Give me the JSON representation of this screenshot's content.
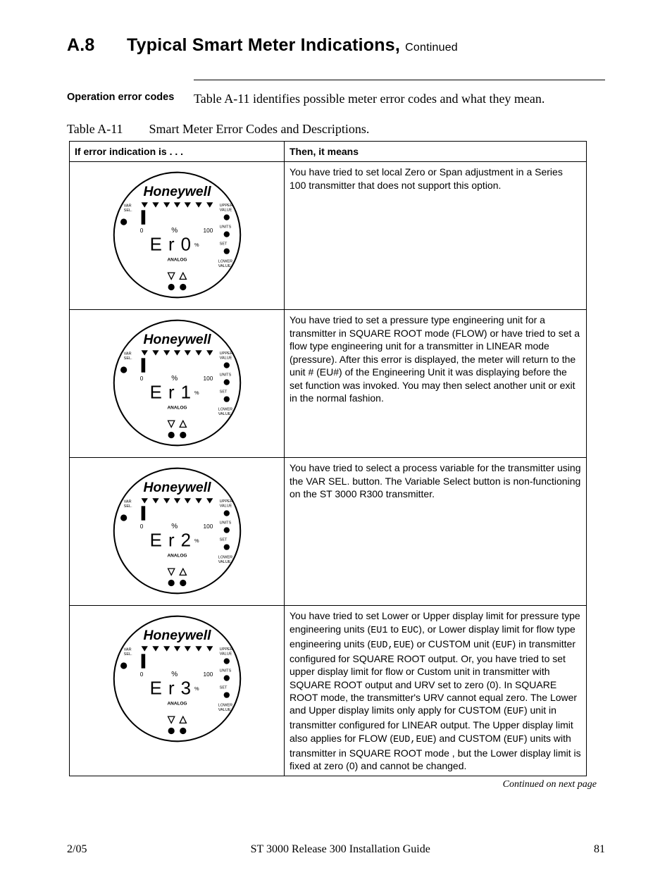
{
  "heading": {
    "number": "A.8",
    "title": "Typical Smart Meter Indications,",
    "cont": "Continued"
  },
  "intro": {
    "label": "Operation error codes",
    "text": "Table A-11 identifies possible meter error codes and what they mean."
  },
  "tableCaption": {
    "label": "Table A-11",
    "title": "Smart Meter Error Codes and Descriptions."
  },
  "headers": {
    "c1": "If error indication is . . .",
    "c2": "Then, it means"
  },
  "rows": [
    {
      "code": "E r 0",
      "desc": "You have tried to set local Zero or Span adjustment in a Series 100 transmitter that does not support this option."
    },
    {
      "code": "E r 1",
      "desc": "You have tried to set a pressure type engineering unit for a transmitter in SQUARE ROOT mode (FLOW) or have tried to set a flow type engineering unit for a transmitter in LINEAR mode (pressure). After this error is displayed, the meter will return to the unit # (EU#) of the Engineering Unit it was displaying before the set function was invoked. You may then select another unit or exit in the normal fashion."
    },
    {
      "code": "E r 2",
      "desc": "You have tried to select a process variable for the transmitter using the VAR SEL. button. The Variable Select button is non-functioning on the ST 3000 R300 transmitter."
    },
    {
      "code": "E r 3",
      "desc_html": "You have tried to set Lower or Upper display limit for pressure type engineering units (<span class=\"mono\">EU1</span> to <span class=\"mono\">EUC</span>), or Lower display limit for flow type engineering units (<span class=\"mono\">EUD,EUE</span>) or CUSTOM unit (<span class=\"mono\">EUF</span>) in transmitter configured for SQUARE ROOT output. Or, you have tried to set upper display limit for flow or Custom unit in transmitter with SQUARE ROOT output and URV set to zero (0). In SQUARE ROOT mode, the transmitter's URV cannot equal zero. The Lower and Upper display limits only apply for CUSTOM (<span class=\"mono\">EUF</span>) unit in transmitter configured for LINEAR output. The Upper display limit also applies for FLOW (<span class=\"mono\">EUD,EUE</span>) and CUSTOM (<span class=\"mono\">EUF</span>) units with transmitter in SQUARE ROOT mode , but the Lower display limit is fixed at zero (0) and cannot be changed."
    }
  ],
  "meterLabels": {
    "brand": "Honeywell",
    "varsel": "VAR\nSEL.",
    "upper": "UPPER\nVALUE",
    "lower": "LOWER\nVALUE",
    "units": "UNITS",
    "set": "SET",
    "percent": "%",
    "analog": "ANALOG",
    "zero": "0",
    "hundred": "100"
  },
  "contNote": "Continued on next page",
  "footer": {
    "left": "2/05",
    "center": "ST 3000 Release 300 Installation Guide",
    "right": "81"
  }
}
